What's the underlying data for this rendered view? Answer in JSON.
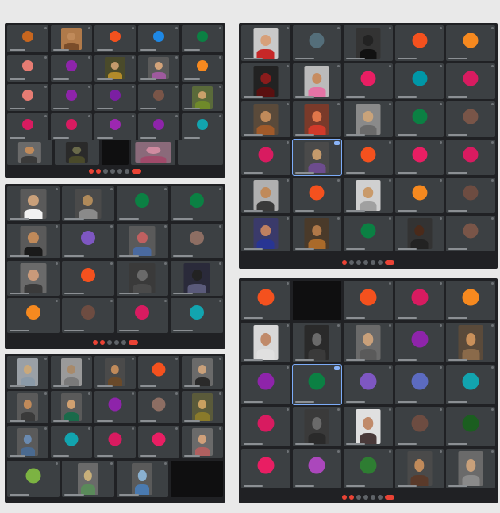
{
  "window": {
    "title": ""
  },
  "colors": {
    "background": "#e9e9e9",
    "panel": "#202124",
    "tile": "#3c4043",
    "end_call": "#ea4335",
    "active_speaker": "#7cacf8"
  },
  "icons": {
    "mic": "mic-muted-icon",
    "end": "end-call-icon",
    "pin": "speaker-indicator-icon"
  },
  "panels": [
    {
      "id": "top-left",
      "cols": 5,
      "rows": 4,
      "tiles": [
        {
          "kind": "avatar",
          "color": "#c7661f"
        },
        {
          "kind": "photo",
          "skin": "#c08a5a",
          "shirt": "#7a4d2a",
          "bg": "#b07a4a"
        },
        {
          "kind": "avatar",
          "color": "#f4511e"
        },
        {
          "kind": "avatar",
          "color": "#1e88e5"
        },
        {
          "kind": "avatar",
          "color": "#0b8043"
        },
        {
          "kind": "avatar",
          "color": "#e67c73"
        },
        {
          "kind": "avatar",
          "color": "#8e24aa"
        },
        {
          "kind": "photo",
          "skin": "#c49a6c",
          "shirt": "#b28b2a",
          "bg": "#4a4a2a"
        },
        {
          "kind": "photo",
          "skin": "#d3a37a",
          "shirt": "#9e5a9e",
          "bg": "#5a5a5a"
        },
        {
          "kind": "avatar",
          "color": "#f6891f"
        },
        {
          "kind": "avatar",
          "color": "#e67c73"
        },
        {
          "kind": "avatar",
          "color": "#8e24aa"
        },
        {
          "kind": "avatar",
          "color": "#7b1fa2"
        },
        {
          "kind": "avatar",
          "color": "#795548"
        },
        {
          "kind": "photo",
          "skin": "#caa06a",
          "shirt": "#6f8a2a",
          "bg": "#5a6a3a"
        },
        {
          "kind": "avatar",
          "color": "#d81b60"
        },
        {
          "kind": "avatar",
          "color": "#d81b60"
        },
        {
          "kind": "avatar",
          "color": "#9c27b0"
        },
        {
          "kind": "avatar",
          "color": "#8e24aa"
        },
        {
          "kind": "avatar",
          "color": "#12a4af"
        }
      ]
    },
    {
      "id": "top-right",
      "cols": 5,
      "rows": 6,
      "tiles": [
        {
          "kind": "photo",
          "skin": "#d7a07a",
          "shirt": "#c62828",
          "bg": "#c9c9c9"
        },
        {
          "kind": "avatar",
          "color": "#546e7a"
        },
        {
          "kind": "photo",
          "skin": "#222",
          "shirt": "#111",
          "bg": "#333"
        },
        {
          "kind": "avatar",
          "color": "#f4511e"
        },
        {
          "kind": "avatar",
          "color": "#f6891f"
        },
        {
          "kind": "photo",
          "skin": "#8a1c1c",
          "shirt": "#5a1010",
          "bg": "#222"
        },
        {
          "kind": "photo",
          "skin": "#c78c60",
          "shirt": "#e573a5",
          "bg": "#bbbbbb"
        },
        {
          "kind": "avatar",
          "color": "#e91e63"
        },
        {
          "kind": "avatar",
          "color": "#0097a7"
        },
        {
          "kind": "avatar",
          "color": "#d81b60"
        },
        {
          "kind": "photo",
          "skin": "#c08a5a",
          "shirt": "#a05a2a",
          "bg": "#5a4a3a"
        },
        {
          "kind": "photo",
          "skin": "#e0764a",
          "shirt": "#d13a2a",
          "bg": "#7a3a2a"
        },
        {
          "kind": "photo",
          "skin": "#c9a37a",
          "shirt": "#6a6a6a",
          "bg": "#8a8a8a"
        },
        {
          "kind": "avatar",
          "color": "#0b8043"
        },
        {
          "kind": "avatar",
          "color": "#795548"
        },
        {
          "kind": "avatar",
          "color": "#d81b60"
        },
        {
          "kind": "photo",
          "skin": "#c49a6c",
          "shirt": "#6d4c8e",
          "bg": "#4a4a4a",
          "active": true
        },
        {
          "kind": "avatar",
          "color": "#f4511e"
        },
        {
          "kind": "avatar",
          "color": "#e91e63"
        },
        {
          "kind": "avatar",
          "color": "#d81b60"
        },
        {
          "kind": "photo",
          "skin": "#c08a5a",
          "shirt": "#3a3a3a",
          "bg": "#b0b0b0"
        },
        {
          "kind": "avatar",
          "color": "#f4511e"
        },
        {
          "kind": "photo",
          "skin": "#c99a6a",
          "shirt": "#a0a0a0",
          "bg": "#d0d0d0"
        },
        {
          "kind": "avatar",
          "color": "#f6891f"
        },
        {
          "kind": "avatar",
          "color": "#6d4c41"
        },
        {
          "kind": "photo",
          "skin": "#c08060",
          "shirt": "#283593",
          "bg": "#3a3a6a"
        },
        {
          "kind": "photo",
          "skin": "#b07848",
          "shirt": "#aa6a2a",
          "bg": "#4a3a2a"
        },
        {
          "kind": "avatar",
          "color": "#0b8043"
        },
        {
          "kind": "photo",
          "skin": "#4a2a1a",
          "shirt": "#222",
          "bg": "#333"
        },
        {
          "kind": "avatar",
          "color": "#795548"
        }
      ]
    },
    {
      "id": "mid-left",
      "cols": 4,
      "rows": 4,
      "tiles": [
        {
          "kind": "photo",
          "skin": "#c9a07a",
          "shirt": "#f2f2f2",
          "bg": "#5a5a5a"
        },
        {
          "kind": "photo",
          "skin": "#b08a5a",
          "shirt": "#8a8a8a",
          "bg": "#4a4a4a"
        },
        {
          "kind": "avatar",
          "color": "#0b8043"
        },
        {
          "kind": "avatar",
          "color": "#0b8043"
        },
        {
          "kind": "photo",
          "skin": "#c08a5a",
          "shirt": "#1a1a1a",
          "bg": "#5a5a5a"
        },
        {
          "kind": "avatar",
          "color": "#7e57c2"
        },
        {
          "kind": "photo",
          "skin": "#c06060",
          "shirt": "#4a6aa0",
          "bg": "#5a5a5a"
        },
        {
          "kind": "avatar",
          "color": "#8d6e63"
        },
        {
          "kind": "photo",
          "skin": "#c99a7a",
          "shirt": "#3a3a3a",
          "bg": "#6a6a6a"
        },
        {
          "kind": "avatar",
          "color": "#f4511e"
        },
        {
          "kind": "photo",
          "skin": "#6a6a6a",
          "shirt": "#4a4a4a",
          "bg": "#3a3a3a"
        },
        {
          "kind": "photo",
          "skin": "#222",
          "shirt": "#5a5a7a",
          "bg": "#2a2a3a"
        },
        {
          "kind": "avatar",
          "color": "#f6891f"
        },
        {
          "kind": "avatar",
          "color": "#6d4c41"
        },
        {
          "kind": "avatar",
          "color": "#d81b60"
        },
        {
          "kind": "avatar",
          "color": "#12a4af"
        }
      ]
    },
    {
      "id": "bottom-left",
      "cols": 5,
      "rows": 3,
      "tiles": [
        {
          "kind": "photo",
          "skin": "#c9a87a",
          "shirt": "#8a9aa8",
          "bg": "#9aa0a6"
        },
        {
          "kind": "photo",
          "skin": "#a88a6a",
          "shirt": "#7a7a7a",
          "bg": "#9a9a9a"
        },
        {
          "kind": "photo",
          "skin": "#c08a5a",
          "shirt": "#6a4a2a",
          "bg": "#4a4a4a"
        },
        {
          "kind": "avatar",
          "color": "#f4511e"
        },
        {
          "kind": "photo",
          "skin": "#c9a07a",
          "shirt": "#2a2a2a",
          "bg": "#6a6a6a"
        },
        {
          "kind": "photo",
          "skin": "#c08a5a",
          "shirt": "#3a3a3a",
          "bg": "#5a5a5a"
        },
        {
          "kind": "photo",
          "skin": "#d0a070",
          "shirt": "#1a6a4a",
          "bg": "#5a5a5a"
        },
        {
          "kind": "avatar",
          "color": "#8e24aa"
        },
        {
          "kind": "avatar",
          "color": "#8d6e63"
        },
        {
          "kind": "photo",
          "skin": "#c9a060",
          "shirt": "#8a7a2a",
          "bg": "#5a5a3a"
        },
        {
          "kind": "photo",
          "skin": "#6a8ab0",
          "shirt": "#4a6a90",
          "bg": "#5a5a5a"
        },
        {
          "kind": "avatar",
          "color": "#12a4af"
        },
        {
          "kind": "avatar",
          "color": "#d81b60"
        },
        {
          "kind": "avatar",
          "color": "#e91e63"
        },
        {
          "kind": "photo",
          "skin": "#d0a07a",
          "shirt": "#b06060",
          "bg": "#6a6a6a"
        }
      ],
      "strip": [
        {
          "kind": "avatar",
          "color": "#7cb342"
        },
        {
          "kind": "photo",
          "skin": "#c9b07a",
          "shirt": "#5a8a5a",
          "bg": "#6a6a6a"
        },
        {
          "kind": "photo",
          "skin": "#8ab0d0",
          "shirt": "#4a7ab0",
          "bg": "#5a5a5a"
        },
        {
          "kind": "dark"
        }
      ]
    },
    {
      "id": "bottom-right",
      "cols": 5,
      "rows": 5,
      "tiles": [
        {
          "kind": "avatar",
          "color": "#f4511e"
        },
        {
          "kind": "dark"
        },
        {
          "kind": "avatar",
          "color": "#f4511e"
        },
        {
          "kind": "avatar",
          "color": "#d81b60"
        },
        {
          "kind": "avatar",
          "color": "#f6891f"
        },
        {
          "kind": "photo",
          "skin": "#c08a6a",
          "shirt": "#e0e0e0",
          "bg": "#d8d8d8"
        },
        {
          "kind": "photo",
          "skin": "#6a6a6a",
          "shirt": "#3a3a3a",
          "bg": "#2a2a2a"
        },
        {
          "kind": "photo",
          "skin": "#c9a07a",
          "shirt": "#5a5a5a",
          "bg": "#6a6a6a"
        },
        {
          "kind": "avatar",
          "color": "#8e24aa"
        },
        {
          "kind": "photo",
          "skin": "#c9905a",
          "shirt": "#8a6a4a",
          "bg": "#5a4a3a"
        },
        {
          "kind": "avatar",
          "color": "#8e24aa"
        },
        {
          "kind": "avatar",
          "color": "#0b8043",
          "active": true
        },
        {
          "kind": "avatar",
          "color": "#7e57c2"
        },
        {
          "kind": "avatar",
          "color": "#5c6bc0"
        },
        {
          "kind": "avatar",
          "color": "#12a4af"
        },
        {
          "kind": "avatar",
          "color": "#d81b60"
        },
        {
          "kind": "photo",
          "skin": "#6a6a6a",
          "shirt": "#2a2a2a",
          "bg": "#3a3a3a"
        },
        {
          "kind": "photo",
          "skin": "#c08a6a",
          "shirt": "#4a3a3a",
          "bg": "#e0e0e0"
        },
        {
          "kind": "avatar",
          "color": "#6d4c41"
        },
        {
          "kind": "avatar",
          "color": "#1b5e20"
        },
        {
          "kind": "avatar",
          "color": "#e91e63"
        },
        {
          "kind": "avatar",
          "color": "#ab47bc"
        },
        {
          "kind": "avatar",
          "color": "#2e7d32"
        },
        {
          "kind": "photo",
          "skin": "#c08a5a",
          "shirt": "#5a3a2a",
          "bg": "#4a4a4a"
        },
        {
          "kind": "photo",
          "skin": "#c9a07a",
          "shirt": "#8a8a8a",
          "bg": "#6a6a6a"
        }
      ]
    }
  ]
}
